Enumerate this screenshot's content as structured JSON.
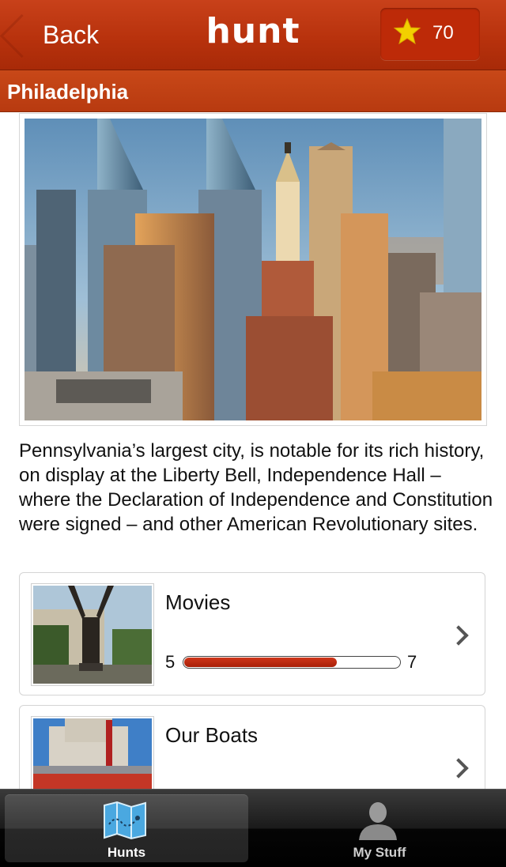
{
  "navbar": {
    "back_label": "Back",
    "logo_text": "hunt",
    "points": "70",
    "star_color": "#f2d000"
  },
  "city": {
    "title": "Philadelphia",
    "description": "Pennsylvania’s largest city, is notable for its rich history, on display at the Liberty Bell, Independence Hall – where the Declaration of Independence and Constitution were signed – and other American Revolutionary sites."
  },
  "hunts": [
    {
      "name": "Movies",
      "progress_min": "5",
      "progress_max": "7",
      "progress_fraction": 0.71
    },
    {
      "name": "Our Boats"
    }
  ],
  "tabbar": {
    "tabs": [
      {
        "label": "Hunts",
        "icon": "map-icon",
        "active": true
      },
      {
        "label": "My Stuff",
        "icon": "person-icon",
        "active": false
      }
    ]
  },
  "colors": {
    "brand": "#b8320d",
    "progress": "#b82508"
  }
}
